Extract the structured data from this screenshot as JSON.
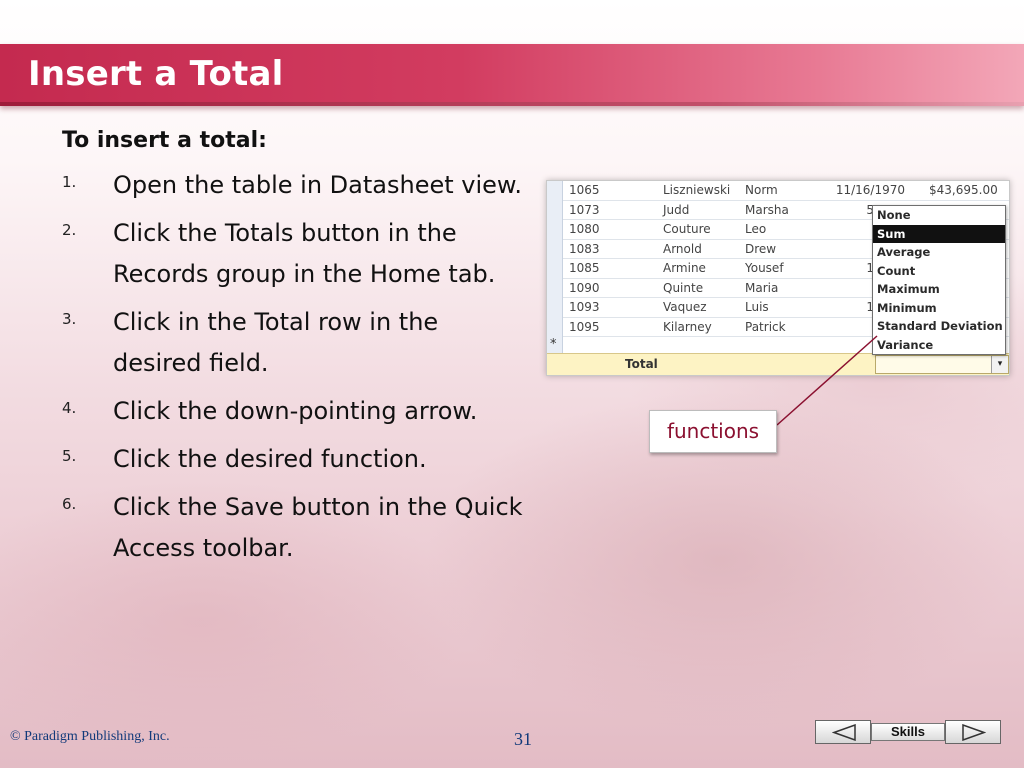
{
  "slide": {
    "title": "Insert a Total",
    "subheading": "To insert a total:"
  },
  "steps": [
    {
      "num": "1.",
      "text": "Open the table in Datasheet view."
    },
    {
      "num": "2.",
      "text": "Click the Totals button in the Records group in the Home tab."
    },
    {
      "num": "3.",
      "text": "Click in the Total row in the desired field."
    },
    {
      "num": "4.",
      "text": "Click the down-pointing arrow."
    },
    {
      "num": "5.",
      "text": "Click the desired function."
    },
    {
      "num": "6.",
      "text": "Click the Save button in the Quick Access toolbar."
    }
  ],
  "datasheet": {
    "rows": [
      [
        "1065",
        "Liszniewski",
        "Norm",
        "11/16/1970",
        "$43,695.00"
      ],
      [
        "1073",
        "Judd",
        "Marsha",
        "5/6/19",
        ""
      ],
      [
        "1080",
        "Couture",
        "Leo",
        "1/8/",
        ""
      ],
      [
        "1083",
        "Arnold",
        "Drew",
        "1/27/",
        ""
      ],
      [
        "1085",
        "Armine",
        "Yousef",
        "11/19/",
        ""
      ],
      [
        "1090",
        "Quinte",
        "Maria",
        "4/16/",
        ""
      ],
      [
        "1093",
        "Vaquez",
        "Luis",
        "11/19/",
        ""
      ],
      [
        "1095",
        "Kilarney",
        "Patrick",
        "2/27/",
        ""
      ]
    ],
    "new_row_marker": "*",
    "total_label": "Total",
    "dropdown_arrow": "▾",
    "functions": [
      "None",
      "Sum",
      "Average",
      "Count",
      "Maximum",
      "Minimum",
      "Standard Deviation",
      "Variance"
    ],
    "selected_function": "Sum"
  },
  "callout": {
    "label": "functions"
  },
  "footer": {
    "copyright": "© Paradigm Publishing, Inc.",
    "page_number": "31",
    "nav_label": "Skills"
  },
  "colors": {
    "title_bar": "#c42a4f",
    "callout_text": "#8b1030",
    "footer_text": "#123a7a"
  }
}
